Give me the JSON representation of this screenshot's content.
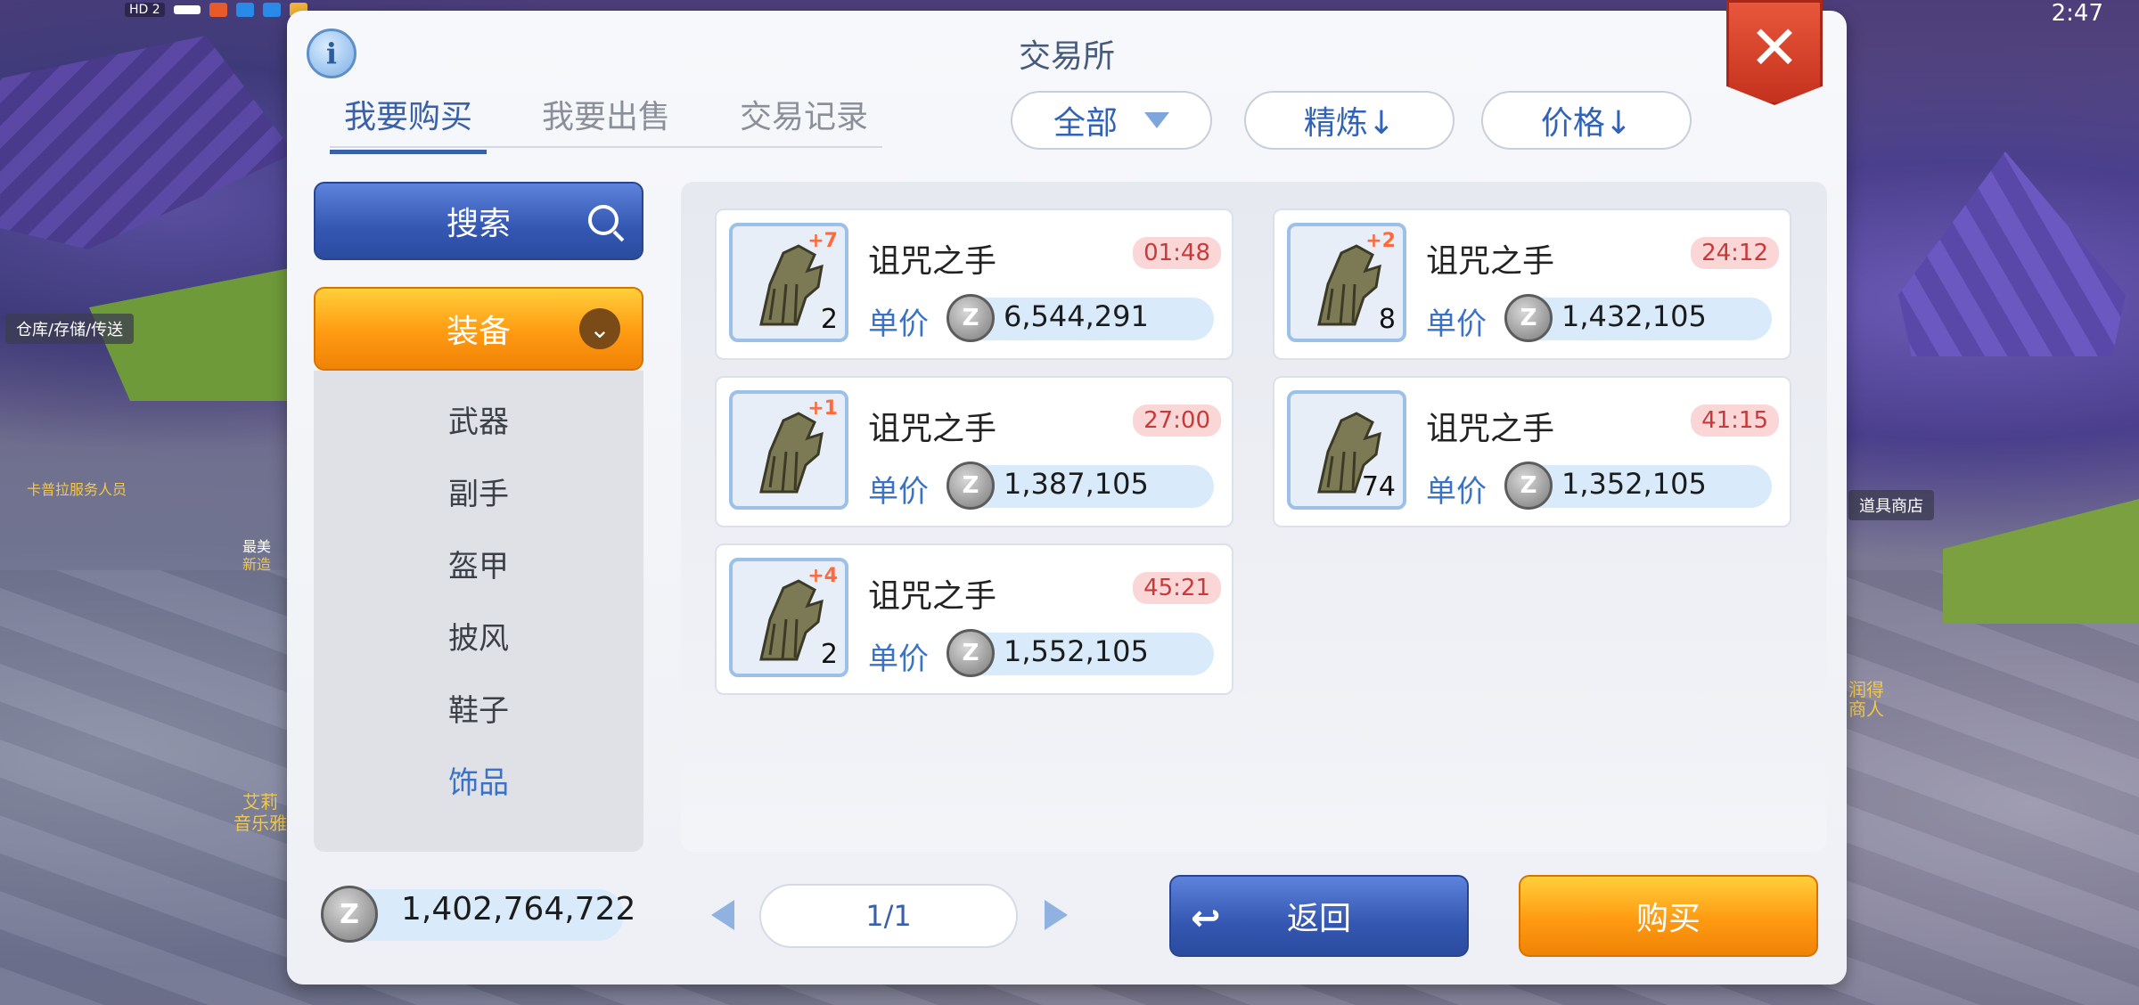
{
  "status_bar": {
    "hd_label": "HD 2",
    "clock": "2:47"
  },
  "scene": {
    "tag_left": "仓库/存储/传送",
    "npc_left": "卡普拉服务人员",
    "npc_left2a": "最美",
    "npc_left2b": "新造",
    "npc_bottom_a": "艾莉",
    "npc_bottom_b": "音乐雅",
    "tag_right": "道具商店",
    "npc_right_a": "润得",
    "npc_right_b": "商人"
  },
  "panel": {
    "title": "交易所",
    "info_icon": "i",
    "close_icon": "✕"
  },
  "tabs": [
    {
      "label": "我要购买",
      "active": true
    },
    {
      "label": "我要出售",
      "active": false
    },
    {
      "label": "交易记录",
      "active": false
    }
  ],
  "filters": {
    "category": "全部",
    "sort_refine": "精炼↓",
    "sort_price": "价格↓"
  },
  "sidebar": {
    "search_label": "搜索",
    "equip_label": "装备",
    "items": [
      {
        "label": "武器",
        "active": false
      },
      {
        "label": "副手",
        "active": false
      },
      {
        "label": "盔甲",
        "active": false
      },
      {
        "label": "披风",
        "active": false
      },
      {
        "label": "鞋子",
        "active": false
      },
      {
        "label": "饰品",
        "active": true
      }
    ]
  },
  "listings": [
    {
      "name": "诅咒之手",
      "refine": "+7",
      "quantity": "2",
      "timer": "01:48",
      "unit_label": "单价",
      "price": "6,544,291"
    },
    {
      "name": "诅咒之手",
      "refine": "+2",
      "quantity": "8",
      "timer": "24:12",
      "unit_label": "单价",
      "price": "1,432,105"
    },
    {
      "name": "诅咒之手",
      "refine": "+1",
      "quantity": "",
      "timer": "27:00",
      "unit_label": "单价",
      "price": "1,387,105"
    },
    {
      "name": "诅咒之手",
      "refine": "",
      "quantity": "74",
      "timer": "41:15",
      "unit_label": "单价",
      "price": "1,352,105"
    },
    {
      "name": "诅咒之手",
      "refine": "+4",
      "quantity": "2",
      "timer": "45:21",
      "unit_label": "单价",
      "price": "1,552,105"
    }
  ],
  "footer": {
    "balance": "1,402,764,722",
    "page": "1/1",
    "back_label": "返回",
    "buy_label": "购买"
  },
  "colors": {
    "accent_blue": "#3a60a8",
    "accent_orange": "#ff9a12",
    "timer_red": "#c83a3a",
    "close_red": "#d43b22"
  }
}
